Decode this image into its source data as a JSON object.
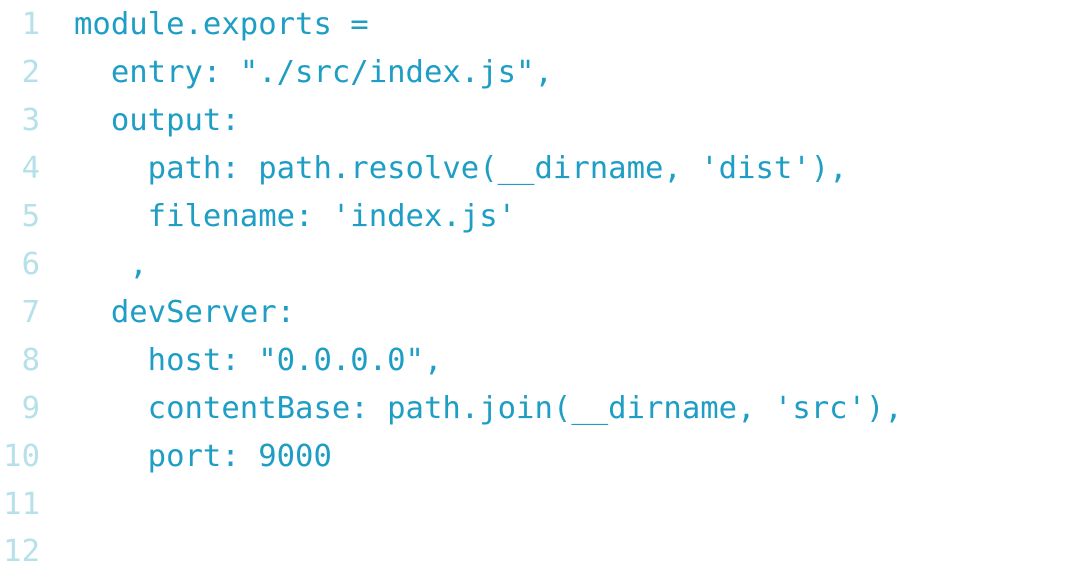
{
  "editor": {
    "text_color": "#1f9ec5",
    "line_number_color": "#b6e0ea",
    "lines": [
      {
        "number": "1",
        "code": "module.exports ="
      },
      {
        "number": "2",
        "code": "  entry: \"./src/index.js\","
      },
      {
        "number": "3",
        "code": "  output:"
      },
      {
        "number": "4",
        "code": "    path: path.resolve(__dirname, 'dist'),"
      },
      {
        "number": "5",
        "code": "    filename: 'index.js'"
      },
      {
        "number": "6",
        "code": "   ,"
      },
      {
        "number": "7",
        "code": "  devServer:"
      },
      {
        "number": "8",
        "code": "    host: \"0.0.0.0\","
      },
      {
        "number": "9",
        "code": "    contentBase: path.join(__dirname, 'src'),"
      },
      {
        "number": "10",
        "code": "    port: 9000"
      },
      {
        "number": "11",
        "code": ""
      },
      {
        "number": "12",
        "code": ""
      }
    ]
  }
}
